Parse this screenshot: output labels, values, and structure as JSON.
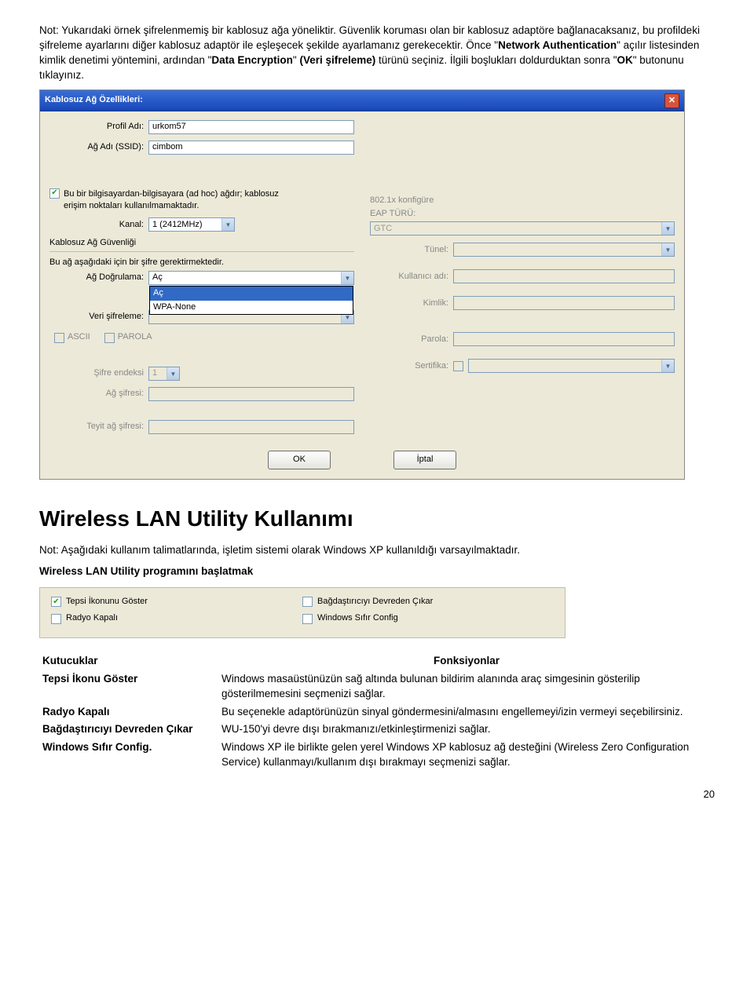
{
  "intro": {
    "p1_a": "Not: Yukarıdaki örnek şifrelenmemiş bir kablosuz ağa yöneliktir. Güvenlik koruması olan bir kablosuz adaptöre bağlanacaksanız, bu profildeki şifreleme ayarlarını diğer kablosuz adaptör ile eşleşecek şekilde ayarlamanız gerekecektir. Önce \"",
    "p1_b": "Network Authentication",
    "p1_c": "\" açılır listesinden kimlik denetimi yöntemini, ardından \"",
    "p1_d": "Data Encryption",
    "p1_e": "\" ",
    "p1_f": "(Veri şifreleme)",
    "p1_g": " türünü seçiniz. İlgili boşlukları doldurduktan sonra \"",
    "p1_h": "OK",
    "p1_i": "\" butonunu tıklayınız."
  },
  "dialog": {
    "title": "Kablosuz Ağ Özellikleri:",
    "left": {
      "profile_label": "Profil Adı:",
      "profile_value": "urkom57",
      "ssid_label": "Ağ Adı (SSID):",
      "ssid_value": "cimbom",
      "adhoc_checkbox": "Bu bir bilgisayardan-bilgisayara (ad hoc) ağdır; kablosuz erişim noktaları kullanılmamaktadır.",
      "channel_label": "Kanal:",
      "channel_value": "1 (2412MHz)",
      "sec_section": "Kablosuz Ağ Güvenliği",
      "sec_desc": "Bu ağ aşağıdaki için bir şifre gerektirmektedir.",
      "auth_label": "Ağ Doğrulama:",
      "auth_value": "Aç",
      "auth_opt1": "Aç",
      "auth_opt2": "WPA-None",
      "enc_label": "Veri şifreleme:",
      "ascii_label": "ASCII",
      "parola_label": "PAROLA",
      "index_label": "Şifre endeksi",
      "index_value": "1",
      "key_label": "Ağ şifresi:",
      "confirm_label": "Teyit ağ şifresi:"
    },
    "right": {
      "eap_section_1": "802.1x konfigüre",
      "eap_section_2": "EAP TÜRÜ:",
      "eap_value": "GTC",
      "tunnel_label": "Tünel:",
      "user_label": "Kullanıcı adı:",
      "id_label": "Kimlik:",
      "pass_label": "Parola:",
      "cert_label": "Sertifika:"
    },
    "ok_btn": "OK",
    "cancel_btn": "İptal"
  },
  "heading": "Wireless LAN Utility Kullanımı",
  "note": "Not: Aşağıdaki kullanım talimatlarında, işletim sistemi olarak Windows XP kullanıldığı varsayılmaktadır.",
  "subheading": "Wireless LAN Utility programını başlatmak",
  "options": {
    "tray": "Tepsi İkonunu Göster",
    "radio": "Radyo Kapalı",
    "disable": "Bağdaştırıcıyı Devreden Çıkar",
    "winzero": "Windows Sıfır Config"
  },
  "table": {
    "h1": "Kutucuklar",
    "h2": "Fonksiyonlar",
    "r1c1": "Tepsi İkonu Göster",
    "r1c2": "Windows masaüstünüzün sağ altında bulunan bildirim alanında araç simgesinin gösterilip gösterilmemesini seçmenizi sağlar.",
    "r2c1": "Radyo Kapalı",
    "r2c2": "Bu seçenekle adaptörünüzün sinyal göndermesini/almasını engellemeyi/izin vermeyi seçebilirsiniz.",
    "r3c1": "Bağdaştırıcıyı Devreden Çıkar",
    "r3c2": "WU-150'yi devre dışı bırakmanızı/etkinleştirmenizi sağlar.",
    "r4c1": "Windows Sıfır Config.",
    "r4c2": "Windows XP ile birlikte gelen yerel Windows XP kablosuz ağ desteğini (Wireless Zero Configuration Service) kullanmayı/kullanım dışı bırakmayı seçmenizi sağlar."
  },
  "page_number": "20"
}
